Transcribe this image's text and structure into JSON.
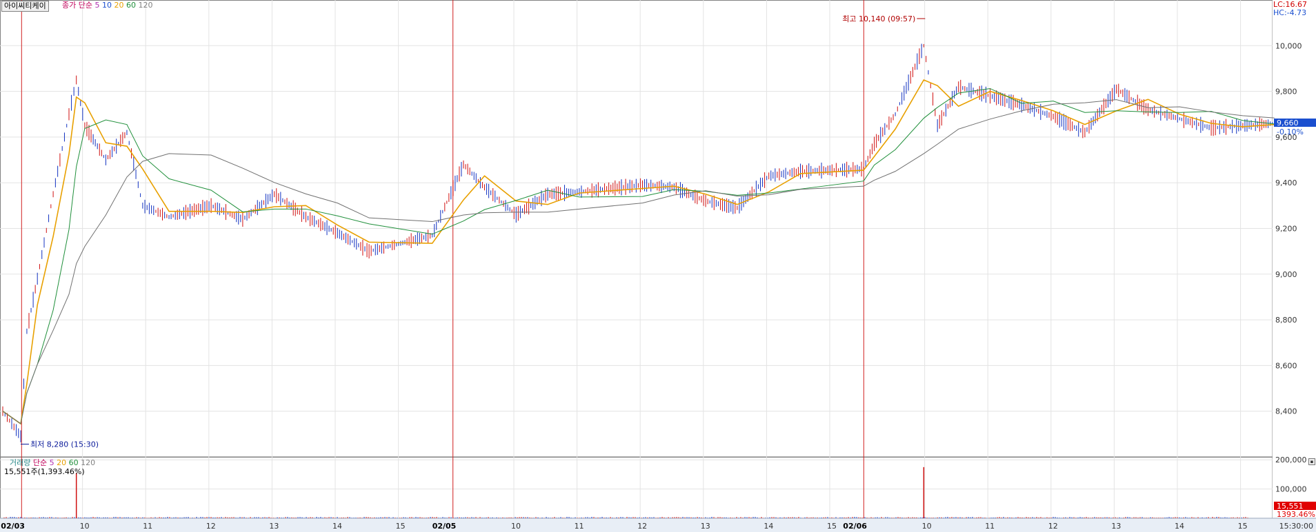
{
  "stock_name": "아이씨티케이",
  "price_legend": {
    "type_label": "종가 단순",
    "periods": [
      {
        "label": "5",
        "color": "#b030b0"
      },
      {
        "label": "10",
        "color": "#1a4fcf"
      },
      {
        "label": "20",
        "color": "#e8a000"
      },
      {
        "label": "60",
        "color": "#1f8f3a"
      },
      {
        "label": "120",
        "color": "#808080"
      }
    ]
  },
  "volume_legend": {
    "name_label": "거래량",
    "type_label": "단순",
    "periods": [
      {
        "label": "5",
        "color": "#b030b0"
      },
      {
        "label": "20",
        "color": "#e8a000"
      },
      {
        "label": "60",
        "color": "#1f8f3a"
      },
      {
        "label": "120",
        "color": "#808080"
      }
    ],
    "current_text": "15,551주(1,393.46%)"
  },
  "top_right": {
    "lc": "LC:16.67",
    "hc": "HC:-4.73"
  },
  "current_price_label": "9,660",
  "current_change_label": "-0.10%",
  "current_volume_label": "15,551",
  "current_volume_pct_label": "1393.46%",
  "time_label": "15:30:00",
  "annotations": {
    "high": "최고 10,140 (09:57)",
    "low": "최저 8,280 (15:30)"
  },
  "chart_data": {
    "type": "candlestick",
    "interval": "minute",
    "title": "",
    "days": [
      "02/03",
      "02/05",
      "02/06"
    ],
    "x_tick_labels": [
      "02/03",
      "10",
      "11",
      "12",
      "13",
      "14",
      "15",
      "02/05",
      "10",
      "11",
      "12",
      "13",
      "14",
      "15",
      "02/06",
      "10",
      "11",
      "12",
      "13",
      "14",
      "15"
    ],
    "y_ticks": [
      "8,400",
      "8,600",
      "8,800",
      "9,000",
      "9,200",
      "9,400",
      "9,600",
      "9,800",
      "10,000"
    ],
    "ylim": [
      8200,
      10200
    ],
    "volume_ticks": [
      "100,000",
      "200,000"
    ],
    "volume_ylim": [
      0,
      210000
    ],
    "high": {
      "value": 10140,
      "time": "02/06 09:57"
    },
    "low": {
      "value": 8280,
      "time": "02/03 15:30"
    },
    "last_close": 9660,
    "last_volume": 15551,
    "price_series": [
      {
        "day": "02/03",
        "t": "15:00",
        "close": 8400
      },
      {
        "day": "02/03",
        "t": "15:30",
        "close": 8290
      },
      {
        "day": "02/03",
        "t": "09:05",
        "close": 8750
      },
      {
        "day": "02/03",
        "t": "09:15",
        "close": 8980
      },
      {
        "day": "02/03",
        "t": "09:30",
        "close": 9350
      },
      {
        "day": "02/03",
        "t": "09:45",
        "close": 9700
      },
      {
        "day": "02/03",
        "t": "09:52",
        "close": 9850
      },
      {
        "day": "02/03",
        "t": "10:00",
        "close": 9650
      },
      {
        "day": "02/03",
        "t": "10:20",
        "close": 9500
      },
      {
        "day": "02/03",
        "t": "10:40",
        "close": 9620
      },
      {
        "day": "02/03",
        "t": "10:55",
        "close": 9300
      },
      {
        "day": "02/03",
        "t": "11:20",
        "close": 9250
      },
      {
        "day": "02/03",
        "t": "12:00",
        "close": 9300
      },
      {
        "day": "02/03",
        "t": "12:30",
        "close": 9240
      },
      {
        "day": "02/03",
        "t": "13:00",
        "close": 9350
      },
      {
        "day": "02/03",
        "t": "13:30",
        "close": 9250
      },
      {
        "day": "02/03",
        "t": "14:00",
        "close": 9180
      },
      {
        "day": "02/03",
        "t": "14:30",
        "close": 9100
      },
      {
        "day": "02/03",
        "t": "15:30",
        "close": 9170
      },
      {
        "day": "02/05",
        "t": "09:10",
        "close": 9480
      },
      {
        "day": "02/05",
        "t": "09:30",
        "close": 9380
      },
      {
        "day": "02/05",
        "t": "10:00",
        "close": 9260
      },
      {
        "day": "02/05",
        "t": "10:30",
        "close": 9350
      },
      {
        "day": "02/05",
        "t": "11:00",
        "close": 9360
      },
      {
        "day": "02/05",
        "t": "12:00",
        "close": 9390
      },
      {
        "day": "02/05",
        "t": "12:30",
        "close": 9380
      },
      {
        "day": "02/05",
        "t": "13:00",
        "close": 9320
      },
      {
        "day": "02/05",
        "t": "13:30",
        "close": 9290
      },
      {
        "day": "02/05",
        "t": "14:00",
        "close": 9430
      },
      {
        "day": "02/05",
        "t": "14:30",
        "close": 9450
      },
      {
        "day": "02/05",
        "t": "15:30",
        "close": 9460
      },
      {
        "day": "02/06",
        "t": "09:10",
        "close": 9570
      },
      {
        "day": "02/06",
        "t": "09:30",
        "close": 9700
      },
      {
        "day": "02/06",
        "t": "09:57",
        "close": 10000
      },
      {
        "day": "02/06",
        "t": "10:10",
        "close": 9650
      },
      {
        "day": "02/06",
        "t": "10:30",
        "close": 9820
      },
      {
        "day": "02/06",
        "t": "11:00",
        "close": 9780
      },
      {
        "day": "02/06",
        "t": "11:30",
        "close": 9740
      },
      {
        "day": "02/06",
        "t": "12:00",
        "close": 9690
      },
      {
        "day": "02/06",
        "t": "12:30",
        "close": 9620
      },
      {
        "day": "02/06",
        "t": "13:00",
        "close": 9810
      },
      {
        "day": "02/06",
        "t": "13:30",
        "close": 9720
      },
      {
        "day": "02/06",
        "t": "14:00",
        "close": 9680
      },
      {
        "day": "02/06",
        "t": "14:30",
        "close": 9640
      },
      {
        "day": "02/06",
        "t": "15:00",
        "close": 9650
      },
      {
        "day": "02/06",
        "t": "15:30",
        "close": 9660
      }
    ],
    "volume_spikes": [
      {
        "day": "02/03",
        "t": "09:52",
        "volume": 155000
      },
      {
        "day": "02/06",
        "t": "09:57",
        "volume": 175000
      }
    ]
  }
}
